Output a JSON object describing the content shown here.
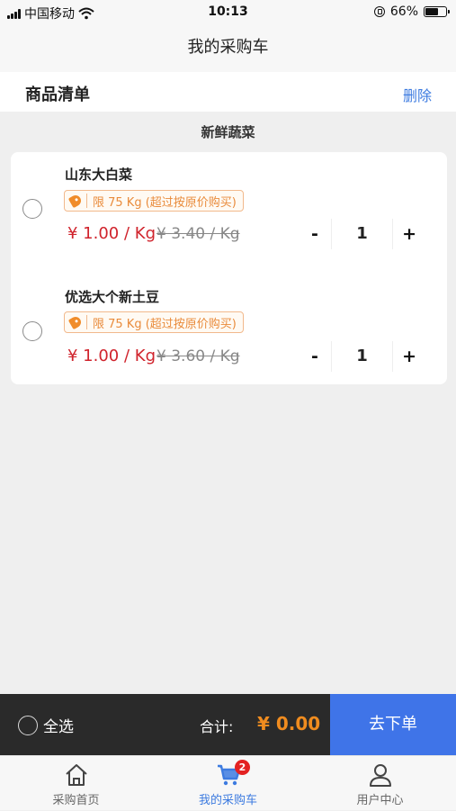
{
  "status_bar": {
    "carrier": "中国移动",
    "time": "10:13",
    "battery_percent": "66%",
    "battery_level": 0.66
  },
  "nav": {
    "title": "我的采购车"
  },
  "list_header": {
    "title": "商品清单",
    "delete_label": "删除"
  },
  "category": {
    "title": "新鲜蔬菜"
  },
  "items": [
    {
      "name": "山东大白菜",
      "limit_text": "限 75 Kg (超过按原价购买)",
      "price": "¥ 1.00 / Kg",
      "original_price": "¥ 3.40 / Kg",
      "quantity": "1",
      "minus_label": "-",
      "plus_label": "+",
      "selected": false
    },
    {
      "name": "优选大个新土豆",
      "limit_text": "限 75 Kg (超过按原价购买)",
      "price": "¥ 1.00 / Kg",
      "original_price": "¥ 3.60 / Kg",
      "quantity": "1",
      "minus_label": "-",
      "plus_label": "+",
      "selected": false
    }
  ],
  "checkout": {
    "select_all_label": "全选",
    "total_label": "合计:",
    "total_amount": "¥ 0.00",
    "submit_label": "去下单"
  },
  "tabs": [
    {
      "label": "采购首页",
      "icon": "home-icon",
      "active": false
    },
    {
      "label": "我的采购车",
      "icon": "cart-icon",
      "active": true,
      "badge": "2"
    },
    {
      "label": "用户中心",
      "icon": "user-icon",
      "active": false
    }
  ],
  "colors": {
    "accent_blue": "#3f74e8",
    "price_red": "#d0232c",
    "total_orange": "#f08c1f",
    "tag_orange": "#e98b3b",
    "checkout_bg": "#2a2a2a",
    "badge_red": "#e32222"
  }
}
